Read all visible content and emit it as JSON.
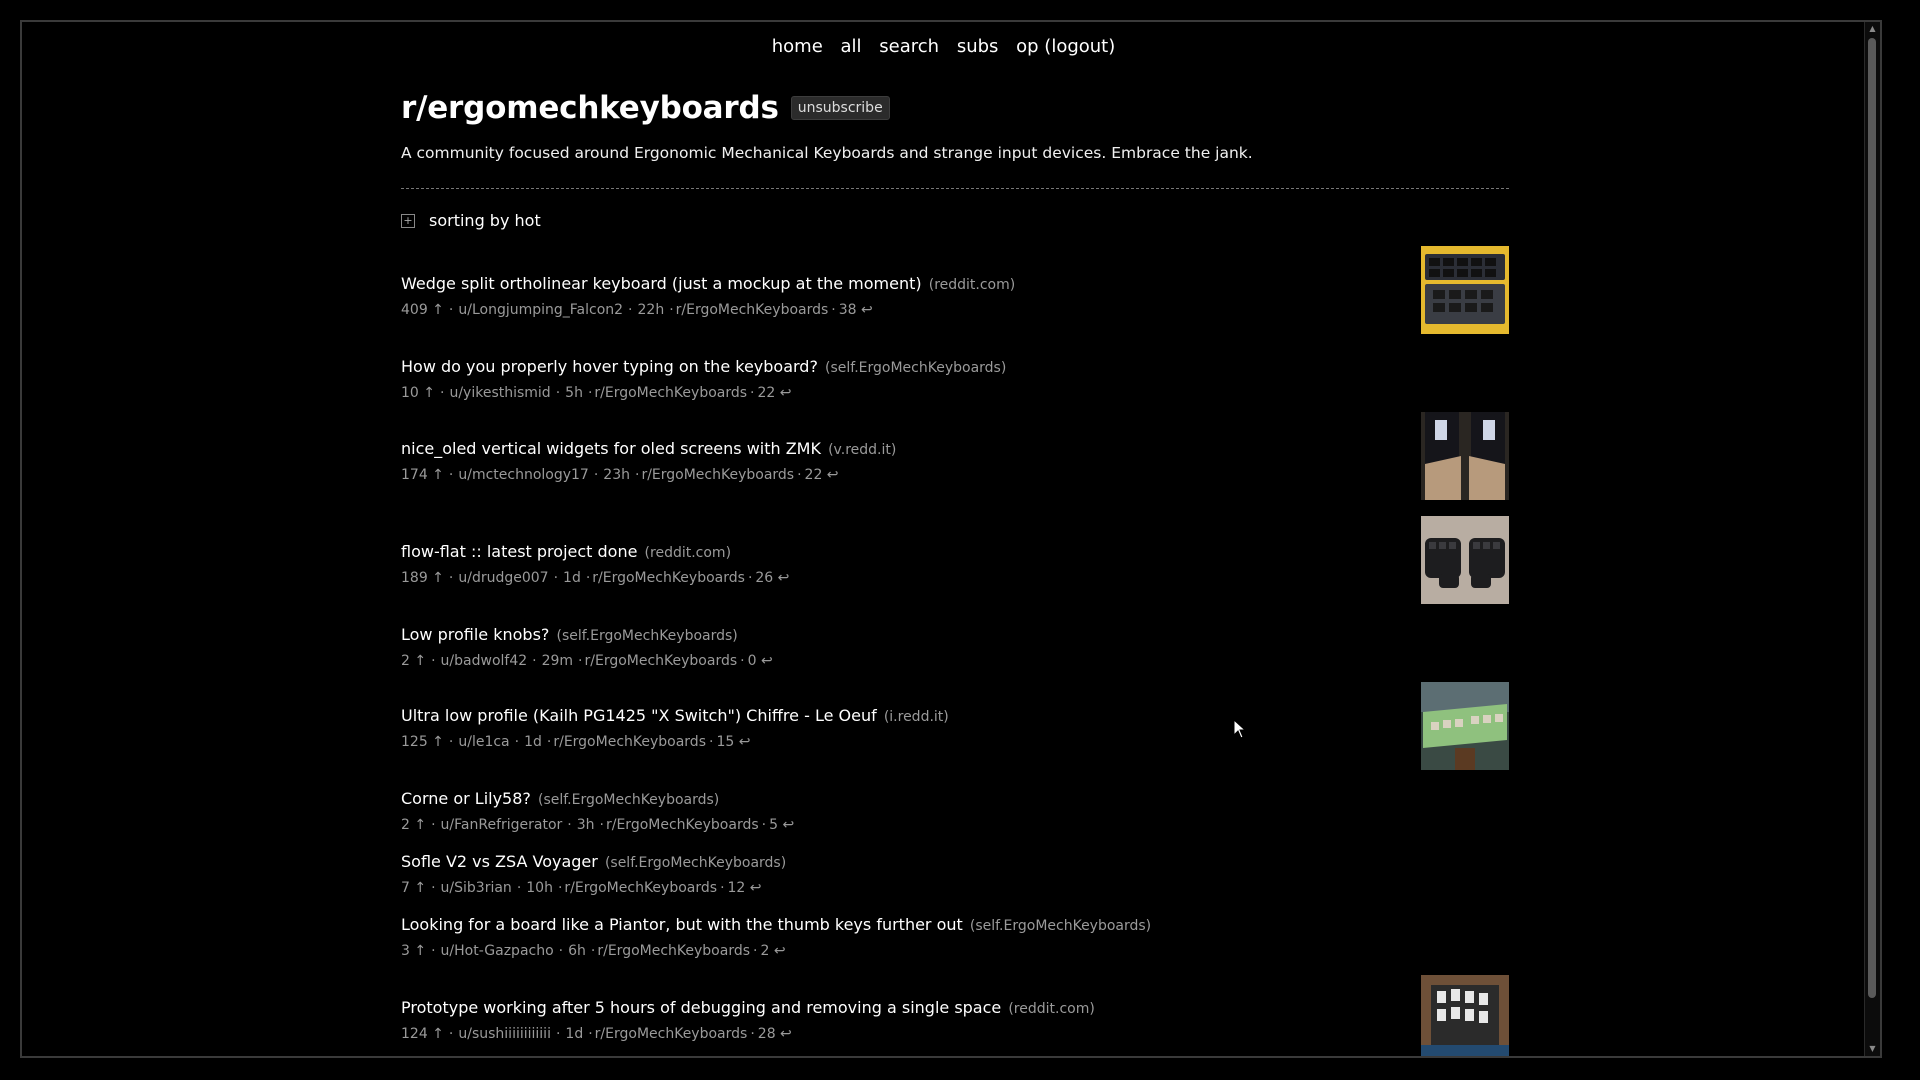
{
  "nav": {
    "home": "home",
    "all": "all",
    "search": "search",
    "subs": "subs",
    "user": "op (logout)"
  },
  "subreddit": {
    "title": "r/ergomechkeyboards",
    "unsubscribe_label": "unsubscribe",
    "description": "A community focused around Ergonomic Mechanical Keyboards and strange input devices. Embrace the jank."
  },
  "sort": {
    "toggle": "+",
    "label": "sorting by hot"
  },
  "posts": [
    {
      "title": "Wedge split ortholinear keyboard (just a mockup at the moment)",
      "domain": "(reddit.com)",
      "score": "409 ↑",
      "author": "u/Longjumping_Falcon2",
      "age": "22h",
      "sub": "r/ErgoMechKeyboards",
      "comments": "38 ↩",
      "thumb": "wedge"
    },
    {
      "title": "How do you properly hover typing on the keyboard?",
      "domain": "(self.ErgoMechKeyboards)",
      "score": "10 ↑",
      "author": "u/yikesthismid",
      "age": "5h",
      "sub": "r/ErgoMechKeyboards",
      "comments": "22 ↩",
      "thumb": ""
    },
    {
      "title": "nice_oled vertical widgets for oled screens with ZMK",
      "domain": "(v.redd.it)",
      "score": "174 ↑",
      "author": "u/mctechnology17",
      "age": "23h",
      "sub": "r/ErgoMechKeyboards",
      "comments": "22 ↩",
      "thumb": "oled"
    },
    {
      "title": "flow-flat :: latest project done",
      "domain": "(reddit.com)",
      "score": "189 ↑",
      "author": "u/drudge007",
      "age": "1d",
      "sub": "r/ErgoMechKeyboards",
      "comments": "26 ↩",
      "thumb": "flow"
    },
    {
      "title": "Low profile knobs?",
      "domain": "(self.ErgoMechKeyboards)",
      "score": "2 ↑",
      "author": "u/badwolf42",
      "age": "29m",
      "sub": "r/ErgoMechKeyboards",
      "comments": "0 ↩",
      "thumb": ""
    },
    {
      "title": "Ultra low profile (Kailh PG1425 \"X Switch\") Chiffre - Le Oeuf",
      "domain": "(i.redd.it)",
      "score": "125 ↑",
      "author": "u/le1ca",
      "age": "1d",
      "sub": "r/ErgoMechKeyboards",
      "comments": "15 ↩",
      "thumb": "chiffre"
    },
    {
      "title": "Corne or Lily58?",
      "domain": "(self.ErgoMechKeyboards)",
      "score": "2 ↑",
      "author": "u/FanRefrigerator",
      "age": "3h",
      "sub": "r/ErgoMechKeyboards",
      "comments": "5 ↩",
      "thumb": ""
    },
    {
      "title": "Sofle V2 vs ZSA Voyager",
      "domain": "(self.ErgoMechKeyboards)",
      "score": "7 ↑",
      "author": "u/Sib3rian",
      "age": "10h",
      "sub": "r/ErgoMechKeyboards",
      "comments": "12 ↩",
      "thumb": ""
    },
    {
      "title": "Looking for a board like a Piantor, but with the thumb keys further out",
      "domain": "(self.ErgoMechKeyboards)",
      "score": "3 ↑",
      "author": "u/Hot-Gazpacho",
      "age": "6h",
      "sub": "r/ErgoMechKeyboards",
      "comments": "2 ↩",
      "thumb": ""
    },
    {
      "title": "Prototype working after 5 hours of debugging and removing a single space",
      "domain": "(reddit.com)",
      "score": "124 ↑",
      "author": "u/sushiiiiiiiiiiii",
      "age": "1d",
      "sub": "r/ErgoMechKeyboards",
      "comments": "28 ↩",
      "thumb": "proto"
    }
  ]
}
